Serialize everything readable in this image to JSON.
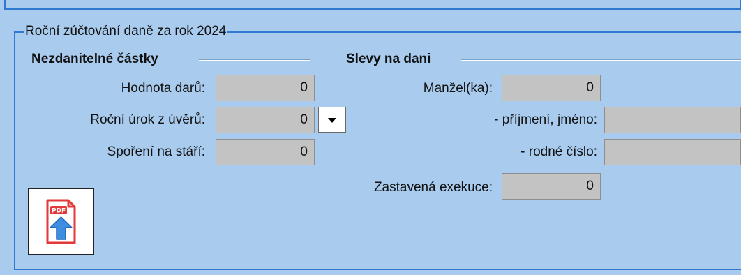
{
  "groupbox": {
    "title": "Roční zúčtování daně za rok 2024"
  },
  "nontaxable": {
    "heading": "Nezdanitelné částky",
    "fields": [
      {
        "label": "Hodnota darů:",
        "value": "0"
      },
      {
        "label": "Roční úrok z úvěrů:",
        "value": "0"
      },
      {
        "label": "Spoření na stáří:",
        "value": "0"
      }
    ]
  },
  "discounts": {
    "heading": "Slevy na dani",
    "spouse": {
      "label": "Manžel(ka):",
      "value": "0"
    },
    "surname_name": {
      "label": "- příjmení, jméno:",
      "value": ""
    },
    "birth_number": {
      "label": "- rodné číslo:",
      "value": ""
    },
    "halted_execution": {
      "label": "Zastavená exekuce:",
      "value": "0"
    }
  },
  "pdf_button": {
    "icon": "pdf-upload-icon",
    "badge": "PDF"
  },
  "colors": {
    "background": "#a9cbee",
    "border": "#2f79d0",
    "field": "#c3c3c3"
  }
}
